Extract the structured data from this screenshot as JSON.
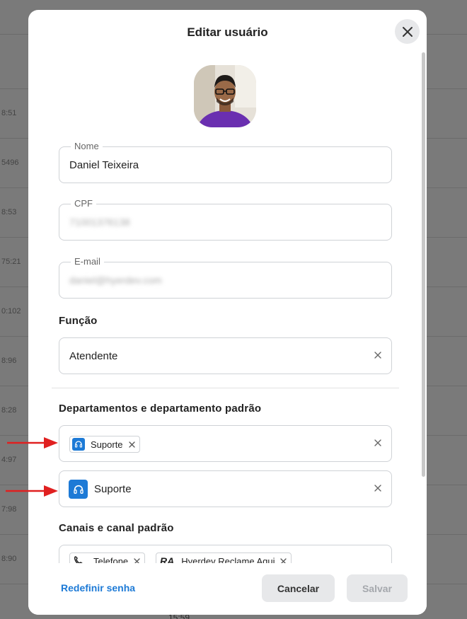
{
  "modal": {
    "title": "Editar usuário",
    "close_icon": "close-icon"
  },
  "background": {
    "rows": [
      "8:51",
      "5496",
      "8:53",
      "75:21",
      "0:102",
      "8:96",
      "8:28",
      "4:97",
      "7:98",
      "8:90"
    ],
    "bottom_time": "15:59"
  },
  "form": {
    "name": {
      "label": "Nome",
      "value": "Daniel Teixeira"
    },
    "cpf": {
      "label": "CPF",
      "value": "71001376138"
    },
    "email": {
      "label": "E-mail",
      "value": "daniel@hyerdev.com"
    },
    "role_section": "Função",
    "role": {
      "value": "Atendente"
    },
    "departments_section": "Departamentos e departamento padrão",
    "departments": {
      "chips": [
        "Suporte"
      ],
      "default": "Suporte"
    },
    "channels_section": "Canais e canal padrão",
    "channels": {
      "chips": [
        "Telefone",
        "Hyerdev Reclame Aqui"
      ]
    }
  },
  "footer": {
    "reset_password": "Redefinir senha",
    "cancel": "Cancelar",
    "save": "Salvar"
  },
  "colors": {
    "accent": "#1d7ad6",
    "arrow": "#e02020"
  }
}
